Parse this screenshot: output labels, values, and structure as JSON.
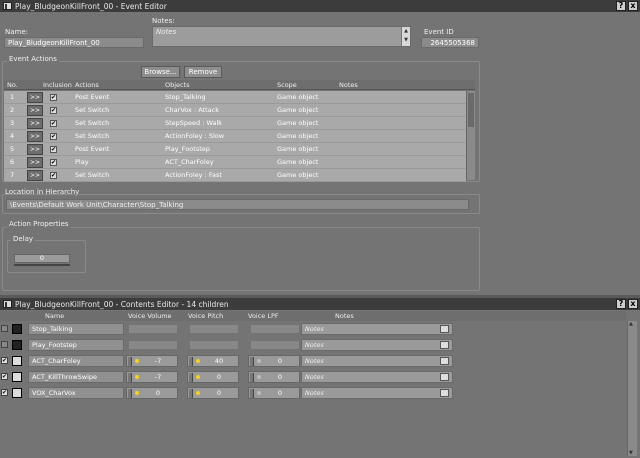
{
  "event_editor": {
    "title": "Play_BludgeonKillFront_00 - Event Editor",
    "name_label": "Name:",
    "name_value": "Play_BludgeonKillFront_00",
    "notes_label": "Notes:",
    "notes_placeholder": "Notes",
    "event_id_label": "Event ID",
    "event_id_value": "2645505368",
    "event_actions_label": "Event Actions",
    "browse_label": "Browse...",
    "remove_label": "Remove",
    "columns": [
      "No.",
      "Inclusion",
      "Actions",
      "Objects",
      "Scope",
      "Notes"
    ],
    "rows": [
      {
        "no": "1",
        "arrows": ">>",
        "check": "✔",
        "action": "Post Event",
        "object": "Stop_Talking",
        "scope": "Game object"
      },
      {
        "no": "2",
        "arrows": ">>",
        "check": "✔",
        "action": "Set Switch",
        "object": "CharVox : Attack",
        "scope": "Game object"
      },
      {
        "no": "3",
        "arrows": ">>",
        "check": "✔",
        "action": "Set Switch",
        "object": "StepSpeed : Walk",
        "scope": "Game object"
      },
      {
        "no": "4",
        "arrows": ">>",
        "check": "✔",
        "action": "Set Switch",
        "object": "ActionFoley : Slow",
        "scope": "Game object"
      },
      {
        "no": "5",
        "arrows": ">>",
        "check": "✔",
        "action": "Post Event",
        "object": "Play_Footstep",
        "scope": "Game object"
      },
      {
        "no": "6",
        "arrows": ">>",
        "check": "✔",
        "action": "Play",
        "object": "ACT_CharFoley",
        "scope": "Game object"
      },
      {
        "no": "7",
        "arrows": ">>",
        "check": "✔",
        "action": "Set Switch",
        "object": "ActionFoley : Fast",
        "scope": "Game object"
      }
    ],
    "location_label": "Location in Hierarchy",
    "location_value": "\\Events\\Default Work Unit\\Character\\Stop_Talking",
    "action_properties_label": "Action Properties",
    "delay_label": "Delay",
    "delay_value": "0"
  },
  "contents_editor": {
    "title": "Play_BludgeonKillFront_00 - Contents Editor - 14 children",
    "columns": [
      "Name",
      "Voice Volume",
      "Voice Pitch",
      "Voice LPF",
      "Notes"
    ],
    "rows": [
      {
        "name": "Stop_Talking",
        "icon": "event-icon",
        "volume": "",
        "pitch": "",
        "lpf": "",
        "notes": "Notes"
      },
      {
        "name": "Play_Footstep",
        "icon": "event-icon",
        "volume": "",
        "pitch": "",
        "lpf": "",
        "notes": "Notes"
      },
      {
        "name": "ACT_CharFoley",
        "icon": "actor-mixer-icon",
        "volume": "-7",
        "pitch": "40",
        "lpf": "0",
        "notes": "Notes"
      },
      {
        "name": "ACT_KillThrowSwipe",
        "icon": "actor-mixer-icon",
        "volume": "-7",
        "pitch": "0",
        "lpf": "0",
        "notes": "Notes"
      },
      {
        "name": "VOX_CharVox",
        "icon": "actor-mixer-icon",
        "volume": "0",
        "pitch": "0",
        "lpf": "0",
        "notes": "Notes"
      }
    ]
  },
  "title_buttons": {
    "help": "?",
    "close": "x"
  },
  "colors": {
    "background": "#747474",
    "titlebar": "#3c3c3c",
    "row": "#a9a9a9",
    "dot_yellow": "#f2d21a"
  }
}
